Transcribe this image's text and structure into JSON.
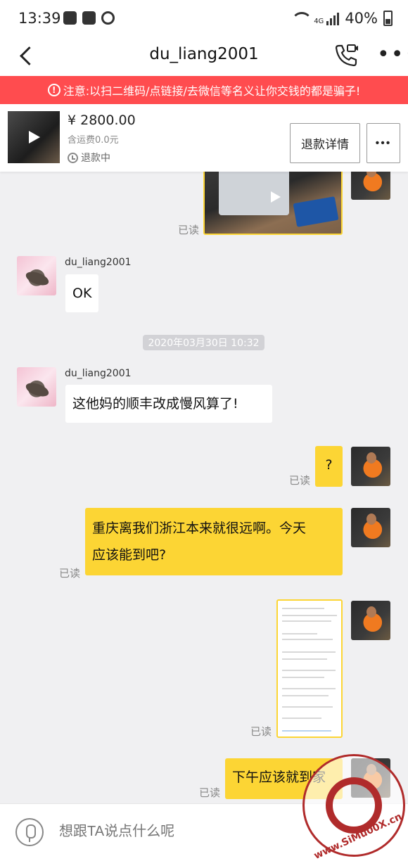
{
  "status_bar": {
    "time": "13:39",
    "network": "4G",
    "battery": "40%"
  },
  "header": {
    "title": "du_liang2001"
  },
  "warning": {
    "text": "注意:以扫二维码/点链接/去微信等名义让你交钱的都是骗子!"
  },
  "product": {
    "price": "¥ 2800.00",
    "shipping": "含运费0.0元",
    "status": "退款中",
    "refund_details_label": "退款详情",
    "more_label": "•••"
  },
  "chat": {
    "messages": [
      {
        "read": "已读"
      },
      {
        "sender": "du_liang2001",
        "text": "OK"
      },
      {
        "timestamp": "2020年03月30日 10:32"
      },
      {
        "sender": "du_liang2001",
        "text": "这他妈的顺丰改成慢风算了!"
      },
      {
        "text": "?",
        "read": "已读"
      },
      {
        "text_line1": "重庆离我们浙江本来就很远啊。今天",
        "text_line2": "应该能到吧?",
        "read": "已读"
      },
      {
        "read": "已读"
      },
      {
        "text": "下午应该就到家",
        "read": "已读"
      }
    ]
  },
  "input": {
    "placeholder": "想跟TA说点什么呢"
  },
  "watermark": {
    "text": "www.SiMu00X.cn"
  }
}
